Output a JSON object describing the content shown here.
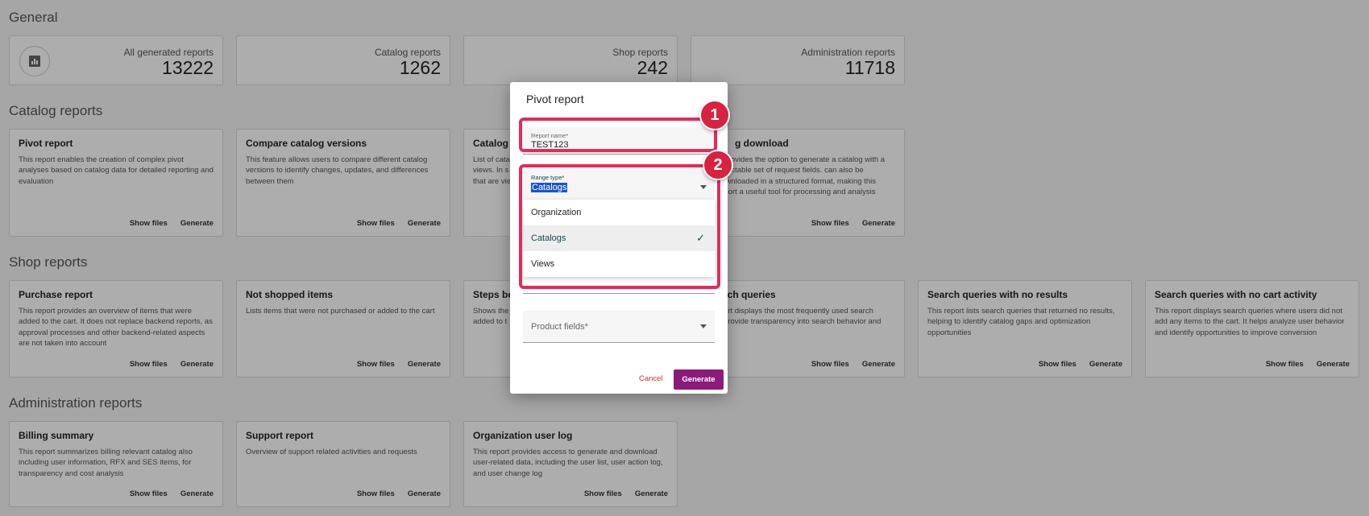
{
  "general": {
    "title": "General",
    "stats": [
      {
        "label": "All generated reports",
        "value": "13222",
        "icon": "chart-icon"
      },
      {
        "label": "Catalog reports",
        "value": "1262"
      },
      {
        "label": "Shop reports",
        "value": "242"
      },
      {
        "label": "Administration reports",
        "value": "11718"
      }
    ]
  },
  "catalog": {
    "title": "Catalog reports",
    "cards": [
      {
        "title": "Pivot report",
        "desc": "This report enables the creation of complex pivot analyses based on catalog data for detailed reporting and evaluation",
        "show": "Show files",
        "gen": "Generate"
      },
      {
        "title": "Compare catalog versions",
        "desc": "This feature allows users to compare different catalog versions to identify changes, updates, and differences between them",
        "show": "Show files",
        "gen": "Generate"
      },
      {
        "title": "Catalog l",
        "desc": "List of cata views. In s that are vie",
        "show": "",
        "gen": ""
      },
      {
        "title": "g download",
        "desc": "rt provides the option to generate a catalog with a selectable set of request fields. can also be downloaded in a structured format, making this report a useful tool for processing and analysis",
        "show": "Show files",
        "gen": "Generate"
      }
    ]
  },
  "shop": {
    "title": "Shop reports",
    "cards": [
      {
        "title": "Purchase report",
        "desc": "This report provides an overview of items that were added to the cart. It does not replace backend reports, as approval processes and other backend-related aspects are not taken into account",
        "show": "Show files",
        "gen": "Generate"
      },
      {
        "title": "Not shopped items",
        "desc": "Lists items that were not purchased or added to the cart",
        "show": "Show files",
        "gen": "Generate"
      },
      {
        "title": "Steps bef",
        "desc": "Shows the added to t",
        "show": "",
        "gen": ""
      },
      {
        "title": "rch queries",
        "desc": "ort displays the most frequently used search provide transparency into search behavior and",
        "show": "Show files",
        "gen": "Generate"
      },
      {
        "title": "Search queries with no results",
        "desc": "This report lists search queries that returned no results, helping to identify catalog gaps and optimization opportunities",
        "show": "Show files",
        "gen": "Generate"
      },
      {
        "title": "Search queries with no cart activity",
        "desc": "This report displays search queries where users did not add any items to the cart. It helps analyze user behavior and identify opportunities to improve conversion",
        "show": "Show files",
        "gen": "Generate"
      }
    ]
  },
  "admin": {
    "title": "Administration reports",
    "cards": [
      {
        "title": "Billing summary",
        "desc": "This report summarizes billing relevant catalog also including user information, RFX and SES items, for transparency and cost analysis",
        "show": "Show files",
        "gen": "Generate"
      },
      {
        "title": "Support report",
        "desc": "Overview of support related activities and requests",
        "show": "Show files",
        "gen": "Generate"
      },
      {
        "title": "Organization user log",
        "desc": "This report provides access to generate and download user-related data, including the user list, user action log, and user change log",
        "show": "Show files",
        "gen": "Generate"
      }
    ]
  },
  "modal": {
    "title": "Pivot report",
    "report_name_label": "Report name*",
    "report_name_value": "TEST123",
    "range_type_label": "Range type*",
    "range_type_value": "Catalogs",
    "options": [
      "Organization",
      "Catalogs",
      "Views"
    ],
    "product_fields_placeholder": "Product fields*",
    "cancel_label": "Cancel",
    "generate_label": "Generate"
  },
  "annotations": {
    "badge1": "1",
    "badge2": "2",
    "highlight_color": "#e8285a"
  }
}
